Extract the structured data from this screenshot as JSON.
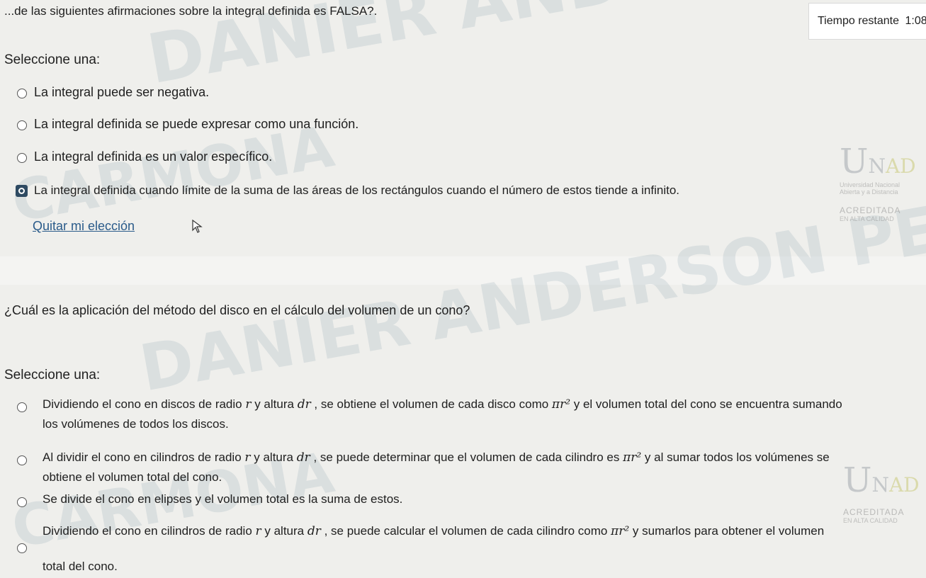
{
  "quiz1": {
    "question": "...de las siguientes afirmaciones sobre la integral definida es FALSA?.",
    "timer_label": "Tiempo restante",
    "timer_value": "1:08",
    "select_label": "Seleccione una:",
    "options": [
      "La integral puede ser negativa.",
      "La integral definida se puede expresar como una función.",
      "La integral definida es un valor específico.",
      "La integral definida cuando límite de la suma de las áreas de los rectángulos cuando el número de estos tiende a infinito."
    ],
    "selected_index": 3,
    "clear_label": "Quitar mi elección"
  },
  "quiz2": {
    "question": "¿Cuál es la aplicación del método del disco en el cálculo del volumen de un cono?",
    "select_label": "Seleccione una:",
    "options": [
      {
        "pre": "Dividiendo el cono en discos de radio ",
        "mid1": " y altura ",
        "mid2": " , se obtiene el volumen de cada disco como ",
        "post": " y el volumen total del cono se encuentra sumando",
        "line2": "los volúmenes de todos los discos."
      },
      {
        "pre": "Al dividir el cono en cilindros de radio ",
        "mid1": " y altura ",
        "mid2": " , se puede determinar que el volumen de cada cilindro es ",
        "post": " y al sumar todos los volúmenes se",
        "line2": "obtiene el volumen total del cono."
      },
      {
        "pre": "Se divide el cono en elipses y el volumen total es la suma de estos."
      },
      {
        "pre": "Dividiendo el cono en cilindros de radio ",
        "mid1": " y altura ",
        "mid2": " , se puede calcular el volumen de cada cilindro como ",
        "post": " y sumarlos para obtener el volumen",
        "line2": "total del cono."
      }
    ]
  },
  "math": {
    "r": "r",
    "dr": "dr",
    "pir2": "πr²"
  },
  "watermarks": {
    "name1": "DANIER ANDERSON PERDOMO",
    "name2": "CARMONA"
  },
  "logo": {
    "letters_big": "U",
    "letters_small": "N",
    "letters_accent": "AD",
    "subtitle1": "Universidad Nacional",
    "subtitle2": "Abierta y a Distancia",
    "accredited": "ACREDITADA",
    "accredited_sub": "EN ALTA CALIDAD"
  },
  "colors": {
    "link": "#2a5b8a",
    "selected_radio": "#2e4a62",
    "background": "#efefec"
  }
}
